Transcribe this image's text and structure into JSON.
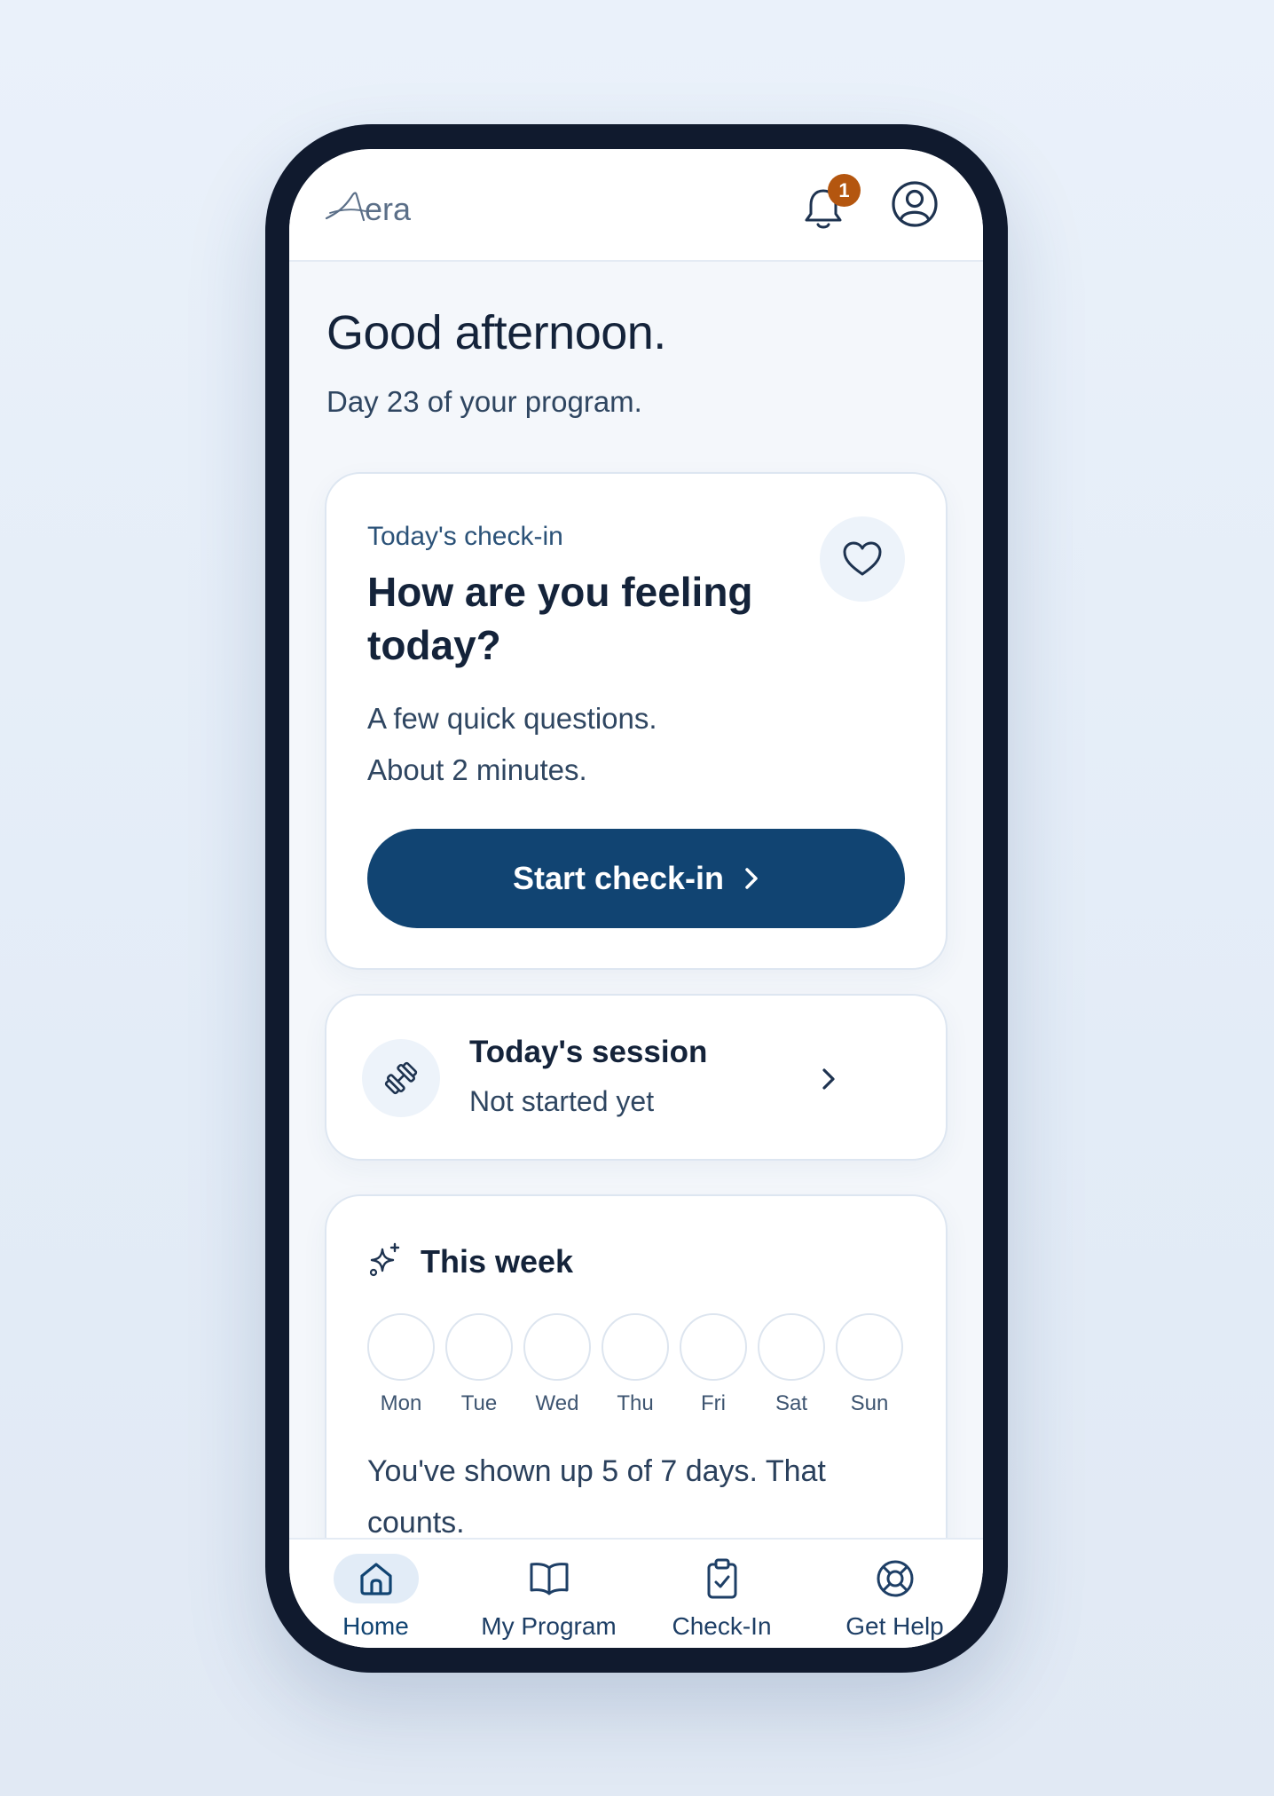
{
  "app": {
    "brand": "Aera",
    "brand_visible_text": "era",
    "notifications_count": "1"
  },
  "greeting": {
    "title": "Good afternoon.",
    "subtitle": "Day 23 of your program."
  },
  "checkin_card": {
    "label": "Today's check-in",
    "title": "How are you feeling today?",
    "desc_line1": "A few quick questions.",
    "desc_line2": "About 2 minutes.",
    "button_label": "Start check-in"
  },
  "session_card": {
    "title": "Today's session",
    "status": "Not started yet"
  },
  "week_card": {
    "title": "This week",
    "days": [
      "Mon",
      "Tue",
      "Wed",
      "Thu",
      "Fri",
      "Sat",
      "Sun"
    ],
    "summary": "You've shown up 5 of 7 days. That counts."
  },
  "bottom_nav": {
    "items": [
      {
        "label": "Home",
        "icon": "home-icon",
        "active": true
      },
      {
        "label": "My Program",
        "icon": "book-icon",
        "active": false
      },
      {
        "label": "Check-In",
        "icon": "clipboard-check-icon",
        "active": false
      },
      {
        "label": "Get Help",
        "icon": "lifebuoy-icon",
        "active": false
      }
    ]
  },
  "colors": {
    "primary": "#114472",
    "badge": "#b4560f",
    "text": "#14233a",
    "background": "#f4f7fb"
  }
}
